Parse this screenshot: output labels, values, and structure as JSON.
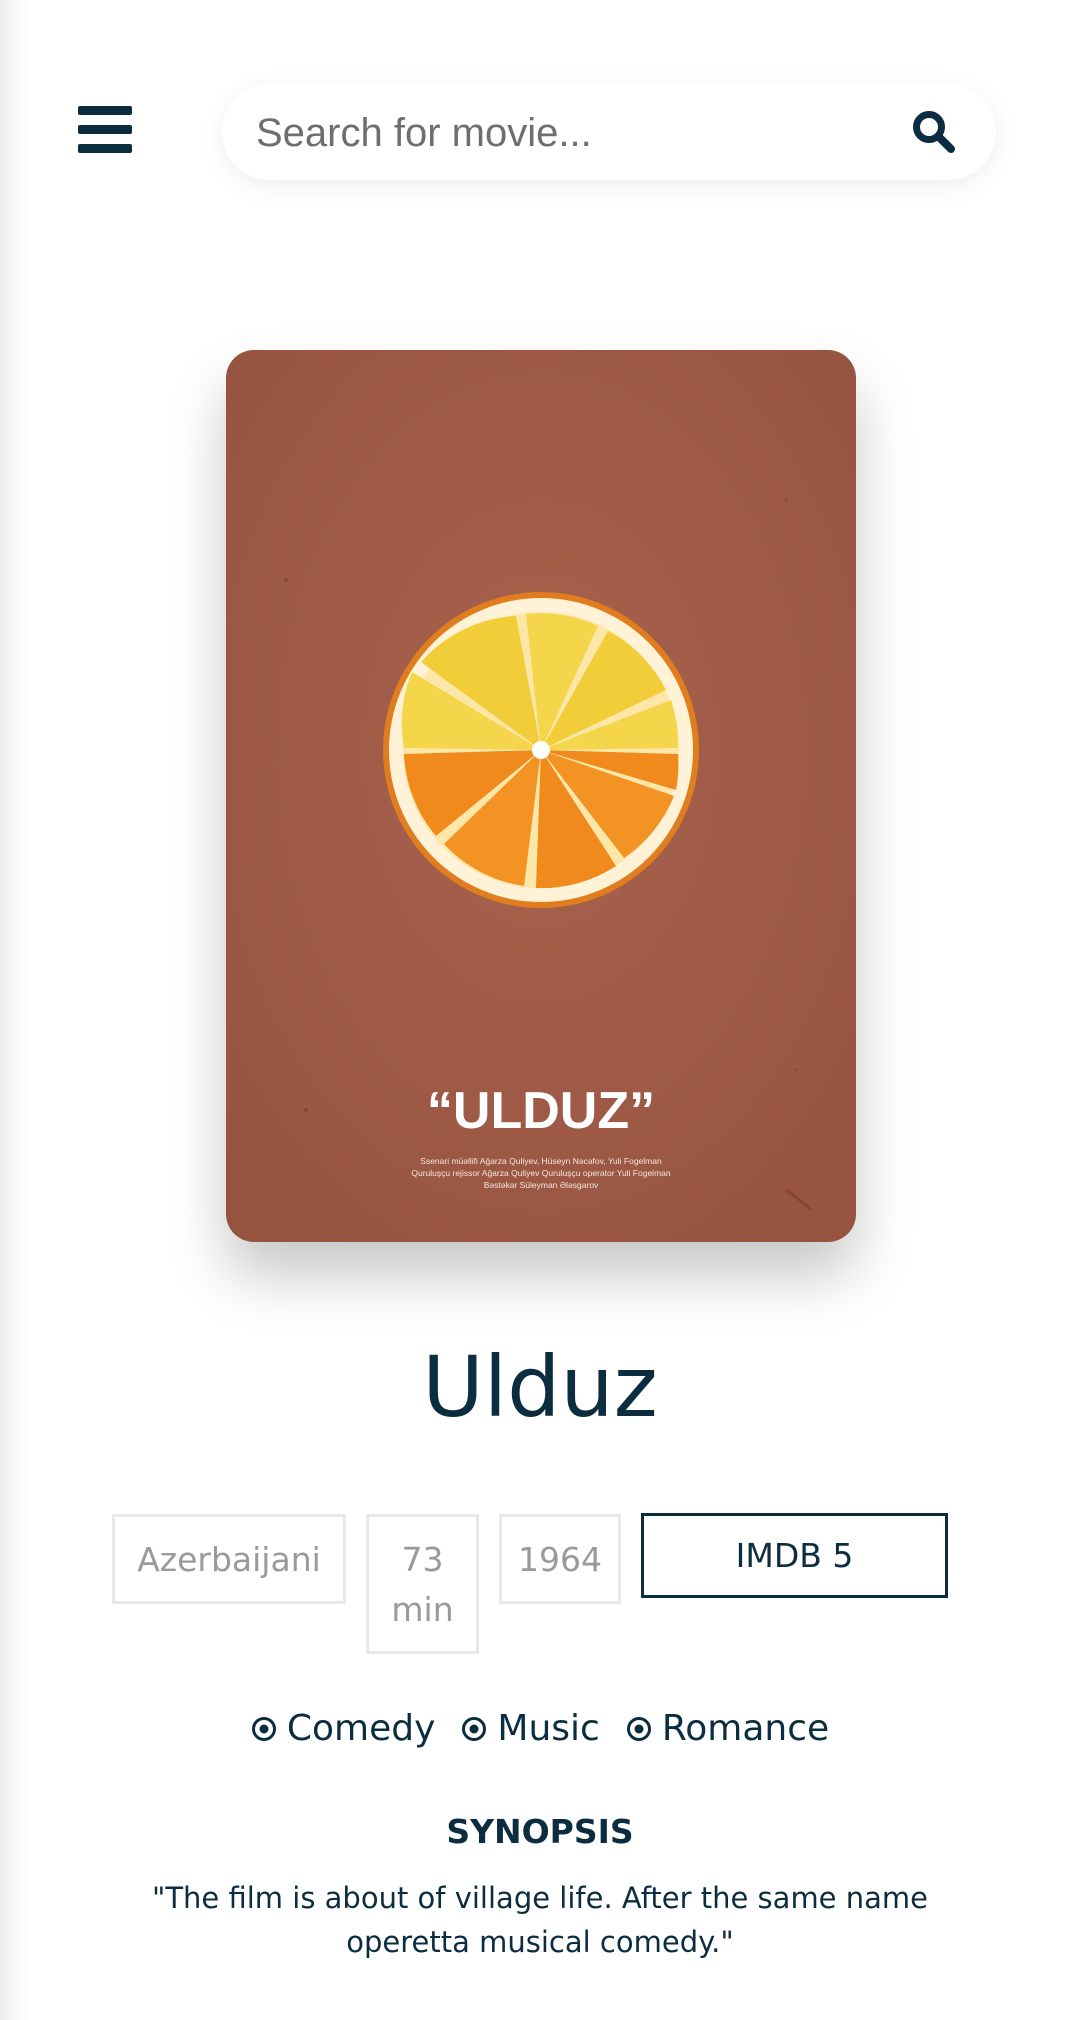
{
  "header": {
    "menu_icon": "hamburger-menu-icon",
    "search": {
      "placeholder": "Search for movie...",
      "value": "",
      "icon": "search-icon"
    }
  },
  "movie": {
    "title": "Ulduz",
    "poster": {
      "title_text": "“ULDUZ”",
      "credits": [
        "Ssenari müəllifi Ağarza Quliyev, Hüseyn Nəcəfov, Yuli Fogelman",
        "Quruluşçu rejissor Ağarza Quliyev Quruluşçu operator Yuli Fogelman",
        "Bəstəkar Süleyman Ələsgarov"
      ],
      "background_color": "#a15c4a"
    },
    "language": "Azerbaijani",
    "runtime": "73 min",
    "year": "1964",
    "imdb": "IMDB 5",
    "genres": [
      "Comedy",
      "Music",
      "Romance"
    ],
    "synopsis_heading": "SYNOPSIS",
    "synopsis": "\"The film is about of village life. After the same name operetta musical comedy.\""
  },
  "colors": {
    "primary": "#0b2d3f",
    "muted_text": "#9a9a9a",
    "border": "#e8e8e8"
  }
}
